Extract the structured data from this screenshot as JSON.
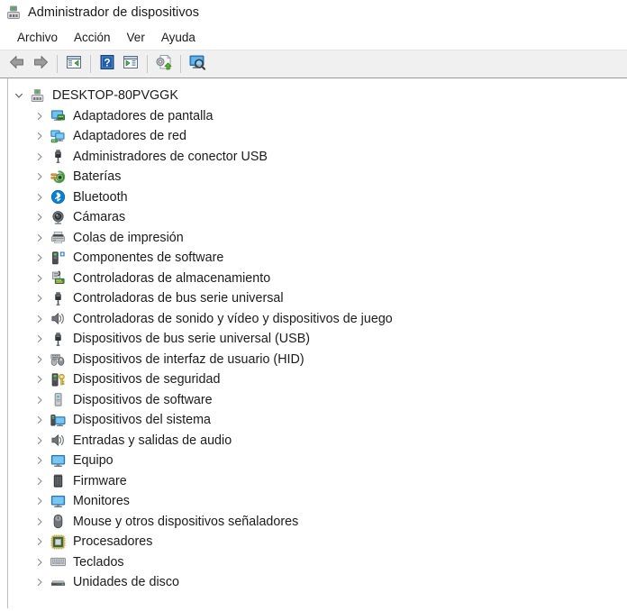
{
  "window": {
    "title": "Administrador de dispositivos",
    "icon": "device-manager-icon"
  },
  "menubar": {
    "items": [
      {
        "label": "Archivo",
        "name": "menu-archivo"
      },
      {
        "label": "Acción",
        "name": "menu-accion"
      },
      {
        "label": "Ver",
        "name": "menu-ver"
      },
      {
        "label": "Ayuda",
        "name": "menu-ayuda"
      }
    ]
  },
  "toolbar": {
    "buttons": [
      {
        "name": "back-button",
        "icon": "back-arrow-icon",
        "tooltip": "Atrás"
      },
      {
        "name": "forward-button",
        "icon": "forward-arrow-icon",
        "tooltip": "Adelante"
      },
      {
        "name": "show-hide-console-tree-button",
        "icon": "console-tree-icon",
        "tooltip": "Mostrar u ocultar árbol de consola"
      },
      {
        "name": "help-button",
        "icon": "help-question-icon",
        "tooltip": "Ayuda"
      },
      {
        "name": "properties-button",
        "icon": "properties-window-icon",
        "tooltip": "Propiedades"
      },
      {
        "name": "update-driver-button",
        "icon": "update-driver-icon",
        "tooltip": "Actualizar controlador"
      },
      {
        "name": "scan-hardware-changes-button",
        "icon": "scan-monitor-icon",
        "tooltip": "Buscar cambios de hardware"
      }
    ]
  },
  "tree": {
    "root": {
      "label": "DESKTOP-80PVGGK",
      "icon": "computer-device-icon",
      "expanded": true,
      "chevron": "chevron-down-icon"
    },
    "items": [
      {
        "label": "Adaptadores de pantalla",
        "icon": "display-adapter-icon",
        "name": "tree-item-adaptadores-de-pantalla"
      },
      {
        "label": "Adaptadores de red",
        "icon": "network-adapter-icon",
        "name": "tree-item-adaptadores-de-red"
      },
      {
        "label": "Administradores de conector USB",
        "icon": "usb-connector-icon",
        "name": "tree-item-administradores-de-conector-usb"
      },
      {
        "label": "Baterías",
        "icon": "battery-icon",
        "name": "tree-item-baterias"
      },
      {
        "label": "Bluetooth",
        "icon": "bluetooth-icon",
        "name": "tree-item-bluetooth"
      },
      {
        "label": "Cámaras",
        "icon": "camera-icon",
        "name": "tree-item-camaras"
      },
      {
        "label": "Colas de impresión",
        "icon": "printer-icon",
        "name": "tree-item-colas-de-impresion"
      },
      {
        "label": "Componentes de software",
        "icon": "software-component-icon",
        "name": "tree-item-componentes-de-software"
      },
      {
        "label": "Controladoras de almacenamiento",
        "icon": "storage-controller-icon",
        "name": "tree-item-controladoras-de-almacenamiento"
      },
      {
        "label": "Controladoras de bus serie universal",
        "icon": "usb-controller-icon",
        "name": "tree-item-controladoras-de-bus-serie-universal"
      },
      {
        "label": "Controladoras de sonido y vídeo y dispositivos de juego",
        "icon": "speaker-icon",
        "name": "tree-item-controladoras-de-sonido-y-video"
      },
      {
        "label": "Dispositivos de bus serie universal (USB)",
        "icon": "usb-device-icon",
        "name": "tree-item-dispositivos-de-bus-serie-universal"
      },
      {
        "label": "Dispositivos de interfaz de usuario (HID)",
        "icon": "hid-device-icon",
        "name": "tree-item-dispositivos-de-interfaz-de-usuario"
      },
      {
        "label": "Dispositivos de seguridad",
        "icon": "security-key-icon",
        "name": "tree-item-dispositivos-de-seguridad"
      },
      {
        "label": "Dispositivos de software",
        "icon": "software-device-icon",
        "name": "tree-item-dispositivos-de-software"
      },
      {
        "label": "Dispositivos del sistema",
        "icon": "system-device-icon",
        "name": "tree-item-dispositivos-del-sistema"
      },
      {
        "label": "Entradas y salidas de audio",
        "icon": "audio-io-icon",
        "name": "tree-item-entradas-y-salidas-de-audio"
      },
      {
        "label": "Equipo",
        "icon": "computer-icon",
        "name": "tree-item-equipo"
      },
      {
        "label": "Firmware",
        "icon": "firmware-chip-icon",
        "name": "tree-item-firmware"
      },
      {
        "label": "Monitores",
        "icon": "monitor-icon",
        "name": "tree-item-monitores"
      },
      {
        "label": "Mouse y otros dispositivos señaladores",
        "icon": "mouse-icon",
        "name": "tree-item-mouse-y-otros-dispositivos"
      },
      {
        "label": "Procesadores",
        "icon": "processor-icon",
        "name": "tree-item-procesadores"
      },
      {
        "label": "Teclados",
        "icon": "keyboard-icon",
        "name": "tree-item-teclados"
      },
      {
        "label": "Unidades de disco",
        "icon": "disk-drive-icon",
        "name": "tree-item-unidades-de-disco"
      }
    ],
    "chevron_collapsed": "chevron-right-icon"
  },
  "colors": {
    "toolbar_bg": "#f0f0f0",
    "window_bg": "#ffffff",
    "text": "#1b1b1b",
    "chevron": "#7a7a7a",
    "accent_blue": "#2c7fd0",
    "accent_green": "#5ba822"
  }
}
